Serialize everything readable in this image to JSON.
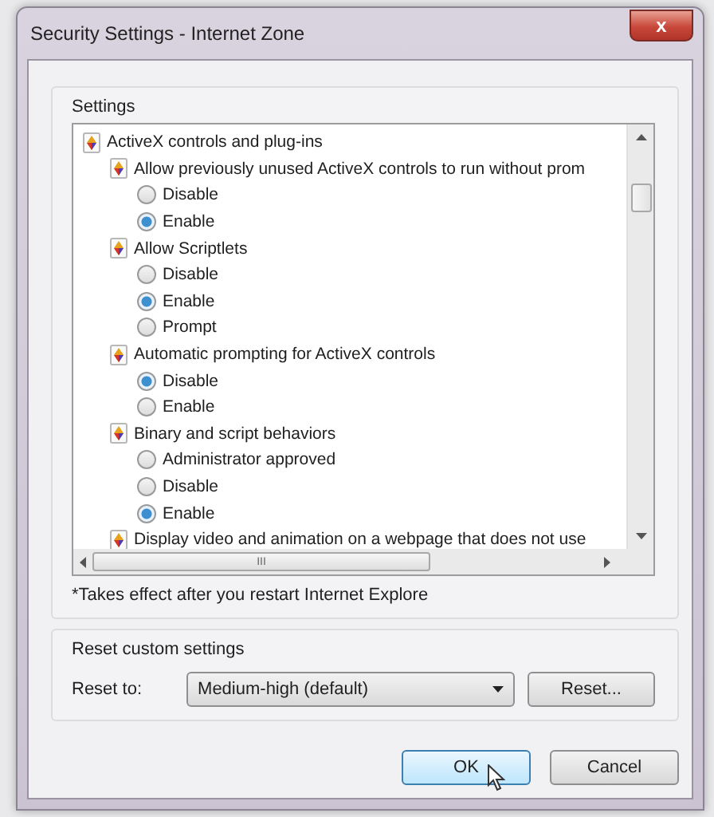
{
  "window": {
    "title": "Security Settings - Internet Zone",
    "close_label": "x"
  },
  "settings_group": {
    "label": "Settings",
    "tree": [
      {
        "kind": "category",
        "label": "ActiveX controls and plug-ins",
        "children": [
          {
            "kind": "setting",
            "label": "Allow previously unused ActiveX controls to run without prom",
            "children": [
              {
                "kind": "option",
                "label": "Disable",
                "selected": false
              },
              {
                "kind": "option",
                "label": "Enable",
                "selected": true
              }
            ]
          },
          {
            "kind": "setting",
            "label": "Allow Scriptlets",
            "children": [
              {
                "kind": "option",
                "label": "Disable",
                "selected": false
              },
              {
                "kind": "option",
                "label": "Enable",
                "selected": true
              },
              {
                "kind": "option",
                "label": "Prompt",
                "selected": false
              }
            ]
          },
          {
            "kind": "setting",
            "label": "Automatic prompting for ActiveX controls",
            "children": [
              {
                "kind": "option",
                "label": "Disable",
                "selected": true
              },
              {
                "kind": "option",
                "label": "Enable",
                "selected": false
              }
            ]
          },
          {
            "kind": "setting",
            "label": "Binary and script behaviors",
            "children": [
              {
                "kind": "option",
                "label": "Administrator approved",
                "selected": false
              },
              {
                "kind": "option",
                "label": "Disable",
                "selected": false
              },
              {
                "kind": "option",
                "label": "Enable",
                "selected": true
              }
            ]
          },
          {
            "kind": "setting",
            "label": "Display video and animation on a webpage that does not use"
          }
        ]
      }
    ],
    "scroll_grip": "III",
    "footnote": "*Takes effect after you restart Internet Explore"
  },
  "reset_group": {
    "label": "Reset custom settings",
    "reset_to_label": "Reset to:",
    "dropdown_value": "Medium-high (default)",
    "reset_button": "Reset..."
  },
  "buttons": [
    {
      "label": "OK",
      "kind": "default"
    },
    {
      "label": "Cancel",
      "kind": "normal"
    }
  ]
}
